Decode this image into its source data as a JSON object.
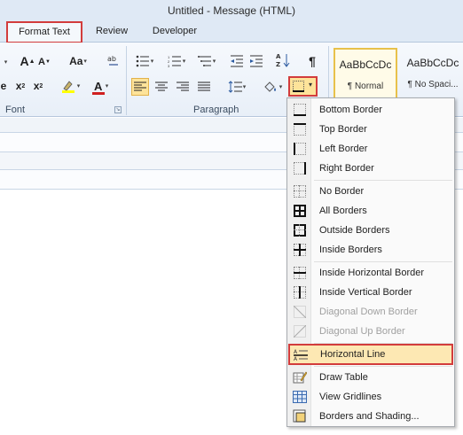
{
  "window": {
    "title": "Untitled  -  Message (HTML)"
  },
  "tabs": [
    {
      "label": "Format Text",
      "active": true
    },
    {
      "label": "Review",
      "active": false
    },
    {
      "label": "Developer",
      "active": false
    }
  ],
  "ribbon": {
    "groups": {
      "font": "Font",
      "paragraph": "Paragraph"
    },
    "font_buttons": {
      "grow": "A",
      "case": "Aa",
      "subscript": "x",
      "superscript": "x",
      "font_color": "A"
    },
    "para_buttons": {
      "sort": "A↓Z",
      "show_marks": "¶"
    },
    "styles": [
      {
        "sample": "AaBbCcDc",
        "name": "¶ Normal",
        "selected": true
      },
      {
        "sample": "AaBbCcDc",
        "name": "¶ No Spaci...",
        "selected": false
      }
    ]
  },
  "borders_menu": {
    "items": [
      {
        "label": "Bottom Border",
        "icon": "bottom-border-icon",
        "enabled": true
      },
      {
        "label": "Top Border",
        "icon": "top-border-icon",
        "enabled": true
      },
      {
        "label": "Left Border",
        "icon": "left-border-icon",
        "enabled": true
      },
      {
        "label": "Right Border",
        "icon": "right-border-icon",
        "enabled": true
      },
      {
        "label": "No Border",
        "icon": "no-border-icon",
        "enabled": true
      },
      {
        "label": "All Borders",
        "icon": "all-borders-icon",
        "enabled": true
      },
      {
        "label": "Outside Borders",
        "icon": "outside-borders-icon",
        "enabled": true
      },
      {
        "label": "Inside Borders",
        "icon": "inside-borders-icon",
        "enabled": true
      },
      {
        "label": "Inside Horizontal Border",
        "icon": "inside-horizontal-border-icon",
        "enabled": true
      },
      {
        "label": "Inside Vertical Border",
        "icon": "inside-vertical-border-icon",
        "enabled": true
      },
      {
        "label": "Diagonal Down Border",
        "icon": "diagonal-down-border-icon",
        "enabled": false
      },
      {
        "label": "Diagonal Up Border",
        "icon": "diagonal-up-border-icon",
        "enabled": false
      },
      {
        "label": "Horizontal Line",
        "icon": "horizontal-line-icon",
        "enabled": true,
        "highlighted": true
      },
      {
        "label": "Draw Table",
        "icon": "draw-table-icon",
        "enabled": true
      },
      {
        "label": "View Gridlines",
        "icon": "view-gridlines-icon",
        "enabled": true
      },
      {
        "label": "Borders and Shading...",
        "icon": "borders-shading-icon",
        "enabled": true
      }
    ]
  },
  "colors": {
    "highlight": "#fde39a",
    "callout": "#d23c3c",
    "ribbon_bg": "#dfe9f5"
  }
}
